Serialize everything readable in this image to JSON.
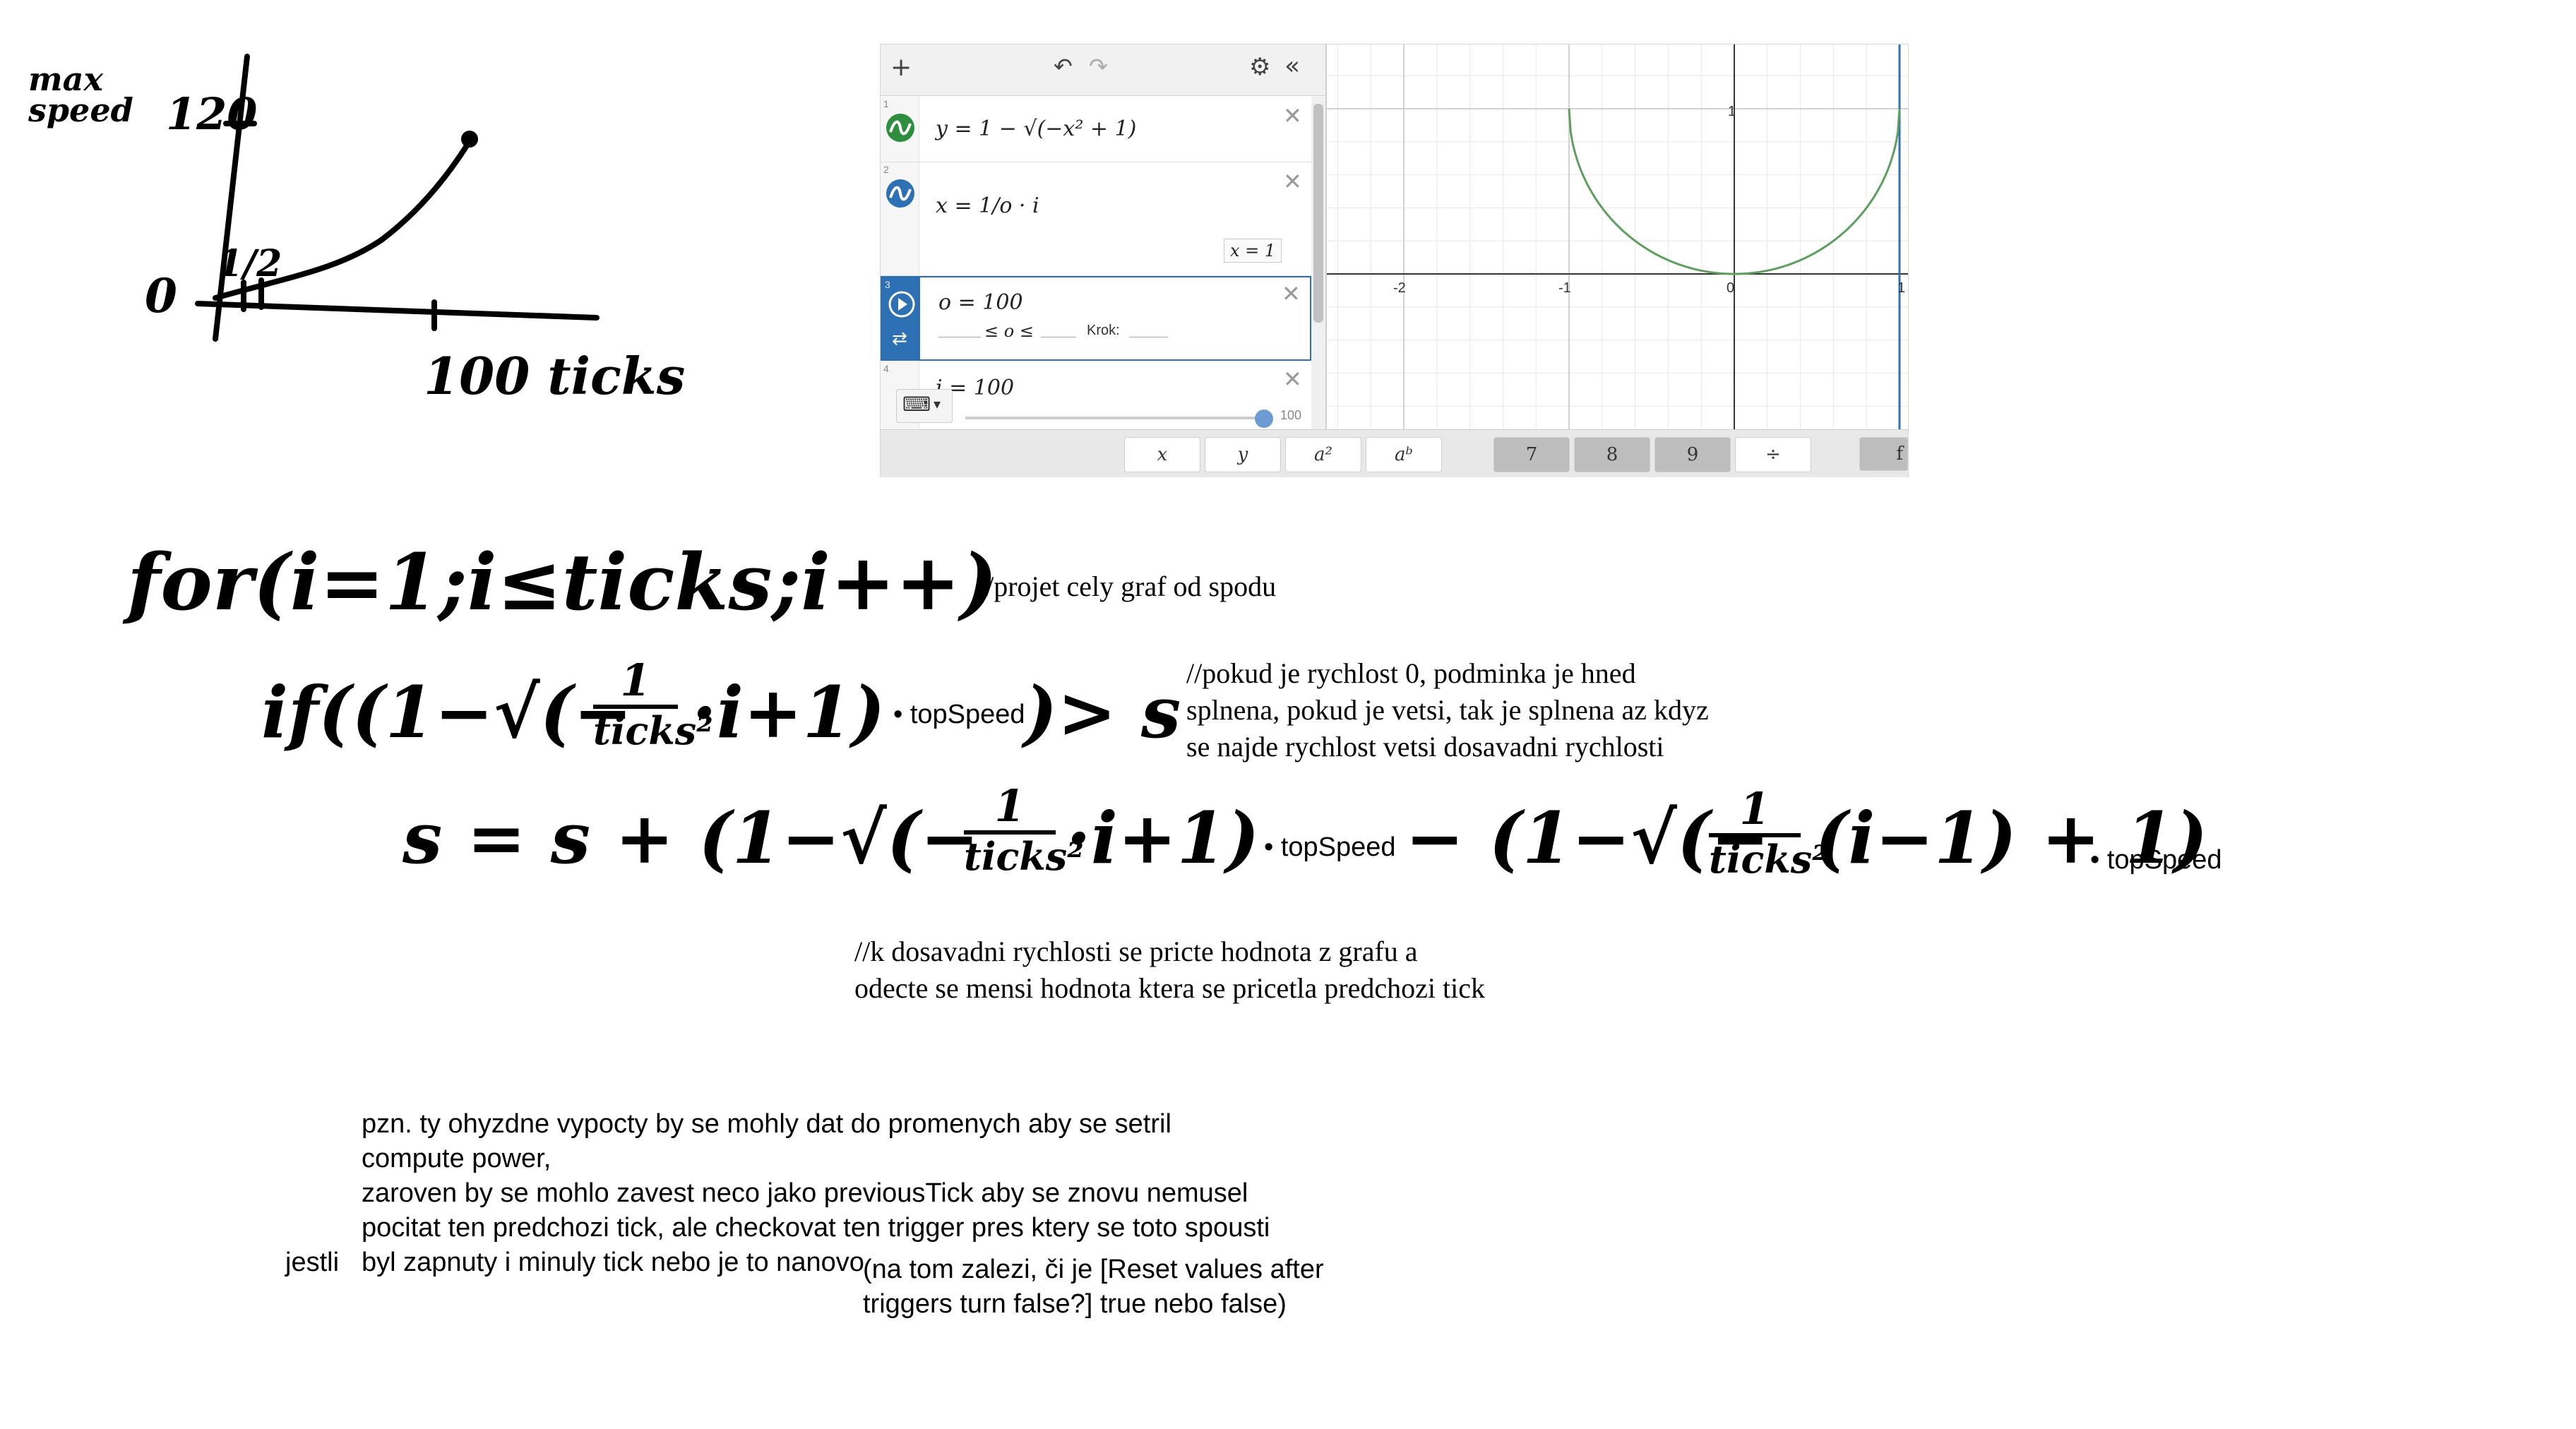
{
  "sketch": {
    "ylabel": "max speed",
    "ytick": "120",
    "origin": "0",
    "small_ticks": "1/2",
    "xlabel": "100 ticks"
  },
  "desmos": {
    "toolbar": {
      "add_icon": "plus-icon",
      "undo_icon": "undo-icon",
      "redo_icon": "redo-icon",
      "settings_icon": "gear-icon",
      "collapse_icon": "double-chevron-left-icon"
    },
    "expressions": [
      {
        "num": "1",
        "latex": "y = 1 − √(−x² + 1)",
        "color": "#2d8e3e"
      },
      {
        "num": "2",
        "latex": "x = 1/o · i",
        "color": "#2d70b3",
        "value": "x = 1"
      },
      {
        "num": "3",
        "latex": "o = 100",
        "slider_mid": "≤ o ≤",
        "step_label": "Krok:"
      },
      {
        "num": "4",
        "latex": "i = 100",
        "slider_max": "100"
      }
    ],
    "graph": {
      "x_ticks": [
        "-2",
        "-1",
        "0",
        "1"
      ],
      "y_ticks": [
        "1"
      ],
      "curve_color": "#5e9e5e",
      "line_color": "#2d70b3"
    },
    "keypad": [
      "x",
      "y",
      "a²",
      "aᵇ",
      "7",
      "8",
      "9",
      "÷",
      "f"
    ]
  },
  "code": {
    "for_line": "for(i=1;i≤ticks;i++)",
    "for_comment": "//projet cely graf od spodu",
    "if_prefix": "if((1−√(−",
    "if_frac_num": "1",
    "if_frac_den": "ticks²",
    "if_suffix": "·i+1)",
    "if_topspeed": "• topSpeed",
    "if_close": ")> s",
    "if_comment": "//pokud je rychlost 0, podminka je hned\nsplnena, pokud je vetsi, tak je splnena az kdyz\nse najde rychlost vetsi dosavadni rychlosti",
    "assign_prefix": "s = s + (1−√(−",
    "assign_frac_num": "1",
    "assign_frac_den": "ticks²",
    "assign_mid": "·i+1)",
    "assign_topspeed1": "• topSpeed",
    "assign_minus": "− (1−√(−",
    "assign_frac2_num": "1",
    "assign_frac2_den": "ticks²",
    "assign_tail": "(i−1) + 1)",
    "assign_topspeed2": "• topSpeed",
    "assign_comment": "//k dosavadni rychlosti se pricte hodnota z grafu a\nodecte se mensi hodnota ktera se pricetla predchozi tick"
  },
  "notes": {
    "para": "pzn. ty ohyzdne vypocty by se mohly dat do promenych aby se setril\ncompute power,\nzaroven by se mohlo zavest neco jako previousTick aby se znovu nemusel\npocitat ten predchozi tick, ale checkovat ten trigger pres ktery se toto spousti\nbyl zapnuty i minuly tick nebo je to nanovo",
    "jestli": "jestli",
    "aside": "(na tom zalezi, či je [Reset values after\ntriggers turn false?] true nebo false)"
  }
}
